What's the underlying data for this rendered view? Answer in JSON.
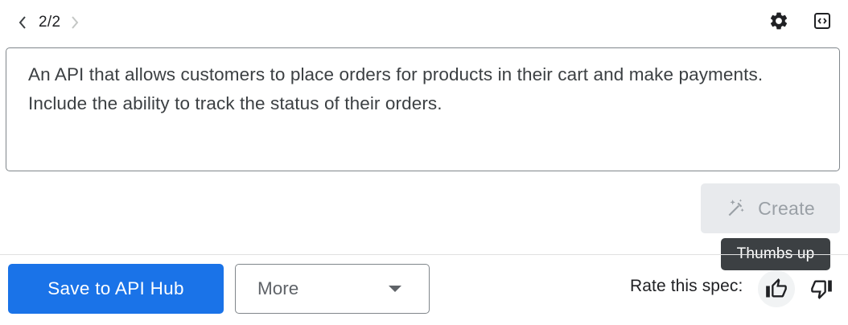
{
  "pager": {
    "counter": "2/2",
    "prev_icon": "chevron-left-icon",
    "next_icon": "chevron-right-icon"
  },
  "top_actions": {
    "settings_icon": "gear-icon",
    "code_icon": "code-view-icon"
  },
  "prompt": {
    "value": "An API that allows customers to place orders for products in their cart and make payments. Include the ability to track the status of their orders."
  },
  "create_button": {
    "label": "Create",
    "icon": "magic-wand-icon",
    "disabled": true
  },
  "tooltip": {
    "text": "Thumbs up"
  },
  "footer": {
    "save_label": "Save to API Hub",
    "more_label": "More",
    "rate_label": "Rate this spec:",
    "thumb_up_icon": "thumb-up-icon",
    "thumb_down_icon": "thumb-down-icon"
  },
  "colors": {
    "primary": "#1a73e8",
    "disabled_bg": "#e8eaed",
    "disabled_text": "#9aa0a6",
    "tooltip_bg": "#3c4043"
  }
}
